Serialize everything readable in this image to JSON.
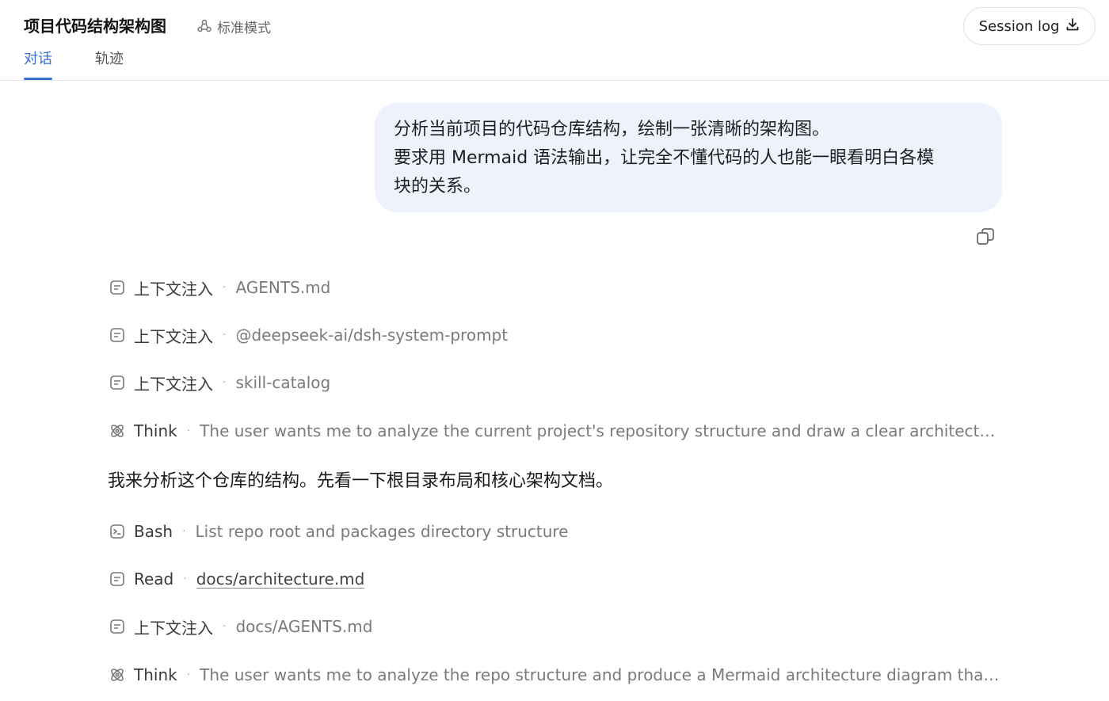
{
  "header": {
    "title": "项目代码结构架构图",
    "mode_label": "标准模式",
    "session_button": "Session log"
  },
  "tabs": [
    {
      "label": "对话",
      "active": true
    },
    {
      "label": "轨迹",
      "active": false
    }
  ],
  "user_message": {
    "lines": [
      "分析当前项目的代码仓库结构，绘制一张清晰的架构图。",
      "要求用 Mermaid 语法输出，让完全不懂代码的人也能一眼看明白各模",
      "块的关系。"
    ]
  },
  "steps": [
    {
      "icon": "document-icon",
      "label": "上下文注入",
      "detail": "AGENTS.md"
    },
    {
      "icon": "document-icon",
      "label": "上下文注入",
      "detail": "@deepseek-ai/dsh-system-prompt"
    },
    {
      "icon": "document-icon",
      "label": "上下文注入",
      "detail": "skill-catalog"
    },
    {
      "icon": "think-icon",
      "label": "Think",
      "detail": "The user wants me to analyze the current project's repository structure and draw a clear architecture ..."
    },
    {
      "icon": "terminal-icon",
      "label": "Bash",
      "detail": "List repo root and packages directory structure"
    },
    {
      "icon": "document-icon",
      "label": "Read",
      "detail": "docs/architecture.md"
    },
    {
      "icon": "document-icon",
      "label": "上下文注入",
      "detail": "docs/AGENTS.md"
    },
    {
      "icon": "think-icon",
      "label": "Think",
      "detail": "The user wants me to analyze the repo structure and produce a Mermaid architecture diagram that no..."
    }
  ],
  "assistant_text": "我来分析这个仓库的结构。先看一下根目录布局和核心架构文档。",
  "colors": {
    "accent": "#3b6fd4",
    "bubble_bg": "#edf2fd"
  }
}
